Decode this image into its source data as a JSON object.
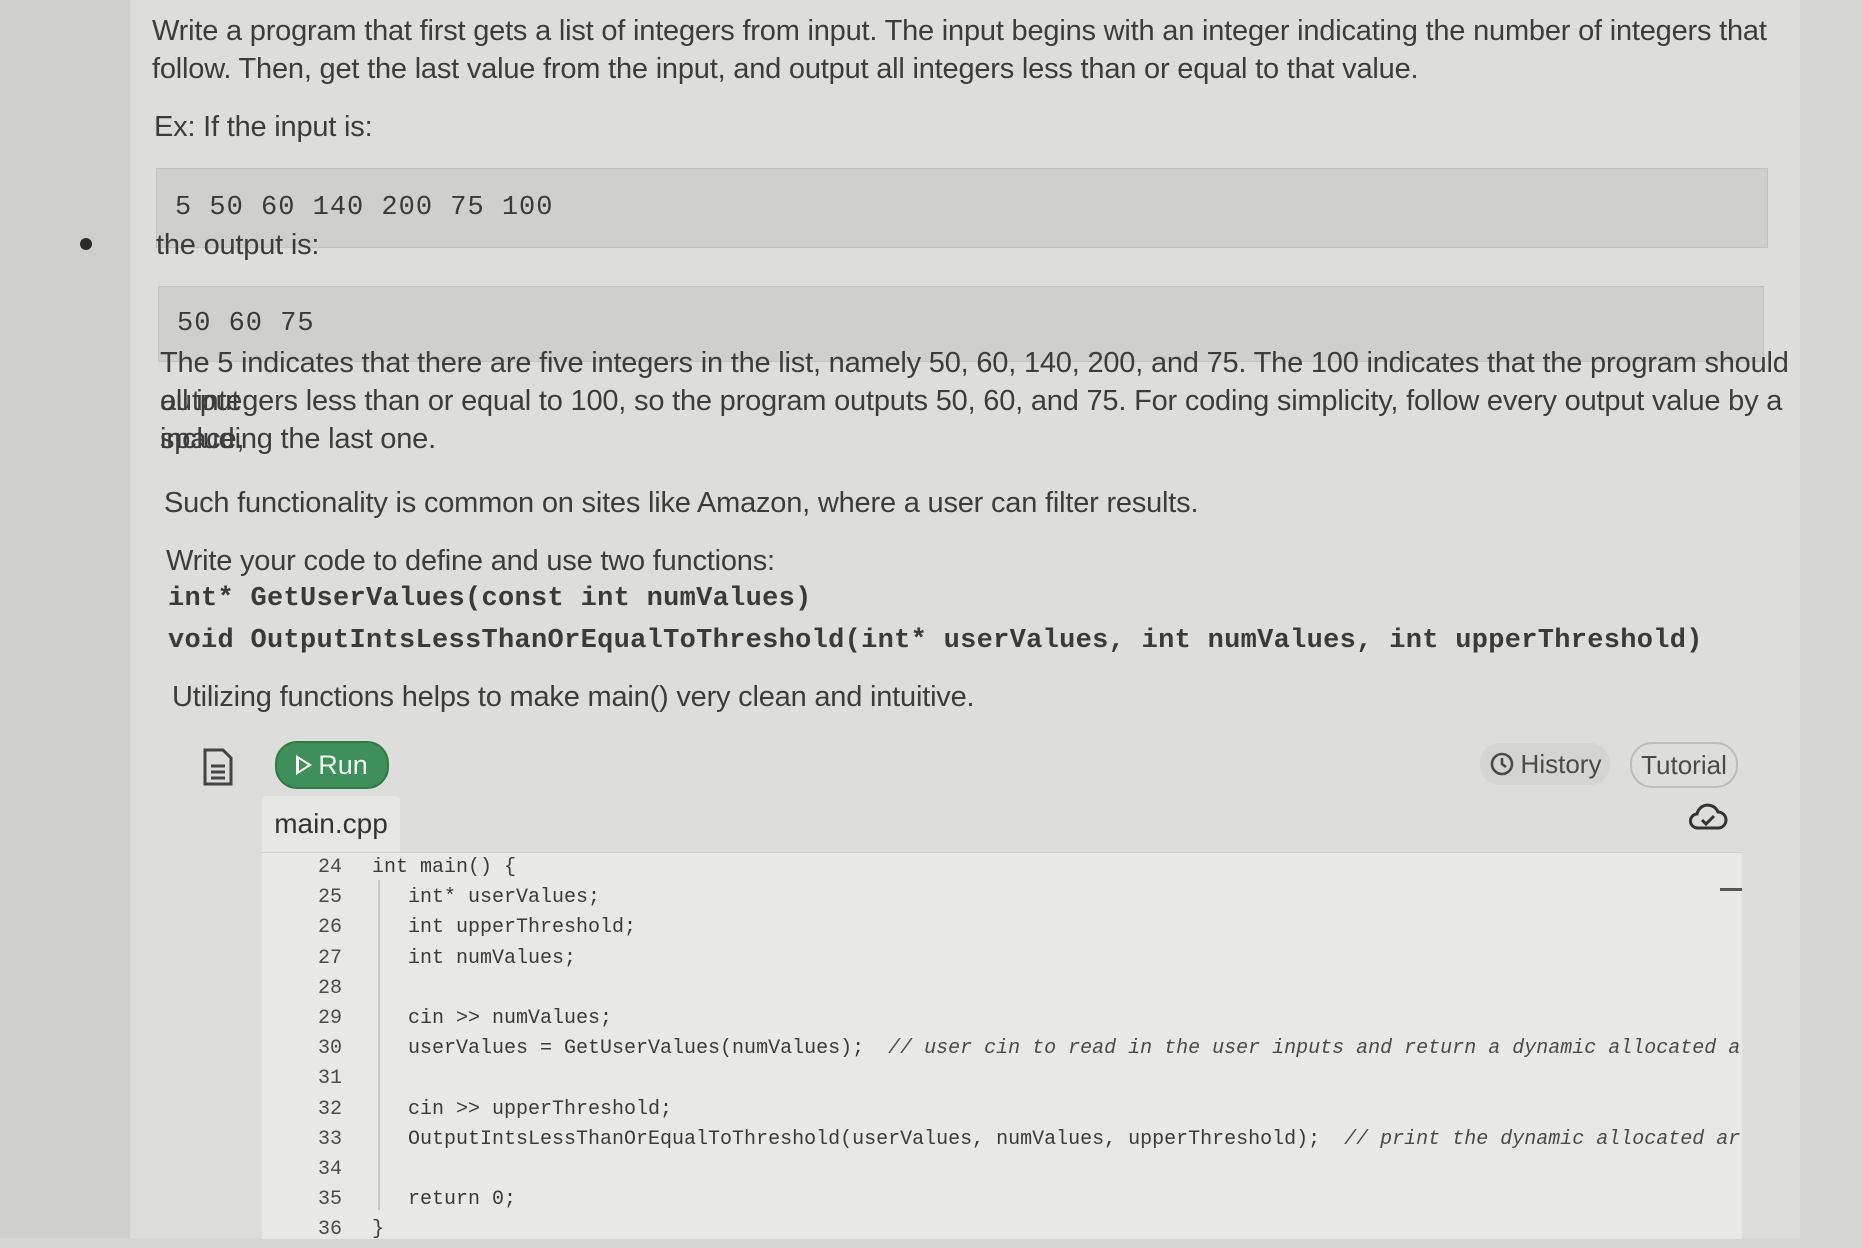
{
  "problem": {
    "intro_line1": "Write a program that first gets a list of integers from input. The input begins with an integer indicating the number of integers that",
    "intro_line2": "follow. Then, get the last value from the input, and output all integers less than or equal to that value.",
    "example_label": "Ex: If the input is:",
    "example_input": "5 50 60 140 200 75 100",
    "output_label": "the output is:",
    "example_output": "50 60 75",
    "explain_line1": "The 5 indicates that there are five integers in the list, namely 50, 60, 140, 200, and 75. The 100 indicates that the program should output",
    "explain_line2": "all integers less than or equal to 100, so the program outputs 50, 60, and 75. For coding simplicity, follow every output value by a space,",
    "explain_line3": "including the last one.",
    "amazon_line": "Such functionality is common on sites like Amazon, where a user can filter results.",
    "functions_intro": "Write your code to define and use two functions:",
    "func1": "int* GetUserValues(const int numValues)",
    "func2": "void OutputIntsLessThanOrEqualToThreshold(int* userValues, int numValues, int upperThreshold)",
    "utilizing_line": "Utilizing functions helps to make main() very clean and intuitive."
  },
  "toolbar": {
    "run_label": "Run",
    "history_label": "History",
    "tutorial_label": "Tutorial"
  },
  "editor": {
    "file_name": "main.cpp",
    "lines": [
      {
        "num": "24",
        "code": "int main() {",
        "comment": ""
      },
      {
        "num": "25",
        "code": "   int* userValues;",
        "comment": ""
      },
      {
        "num": "26",
        "code": "   int upperThreshold;",
        "comment": ""
      },
      {
        "num": "27",
        "code": "   int numValues;",
        "comment": ""
      },
      {
        "num": "28",
        "code": "",
        "comment": ""
      },
      {
        "num": "29",
        "code": "   cin >> numValues;",
        "comment": ""
      },
      {
        "num": "30",
        "code": "   userValues = GetUserValues(numValues);  ",
        "comment": "// user cin to read in the user inputs and return a dynamic allocated a"
      },
      {
        "num": "31",
        "code": "",
        "comment": ""
      },
      {
        "num": "32",
        "code": "   cin >> upperThreshold;",
        "comment": ""
      },
      {
        "num": "33",
        "code": "   OutputIntsLessThanOrEqualToThreshold(userValues, numValues, upperThreshold);  ",
        "comment": "// print the dynamic allocated ar"
      },
      {
        "num": "34",
        "code": "",
        "comment": ""
      },
      {
        "num": "35",
        "code": "   return 0;",
        "comment": ""
      },
      {
        "num": "36",
        "code": "}",
        "comment": ""
      }
    ]
  }
}
